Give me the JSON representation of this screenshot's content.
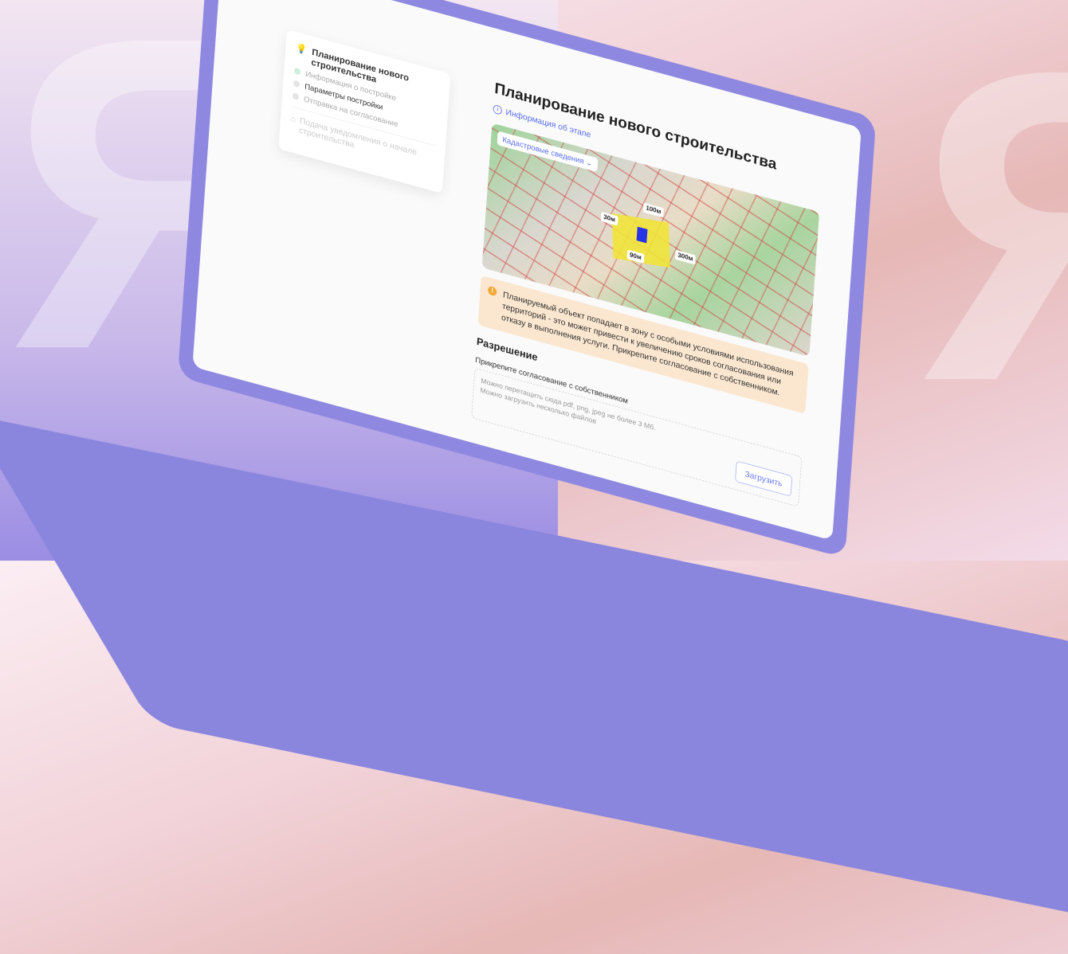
{
  "background": {
    "letter": "Я"
  },
  "stepper": {
    "title": "Планирование нового строительства",
    "steps": [
      {
        "label": "Информация о постройке",
        "state": "done"
      },
      {
        "label": "Параметры постройки",
        "state": "active"
      },
      {
        "label": "Отправка на согласование",
        "state": "pending"
      }
    ],
    "next_stage": "Подача уведомления о начале строительства"
  },
  "main": {
    "title": "Планирование нового строительства",
    "info_link": "Информация об этапе",
    "map": {
      "dropdown": "Кадастровые сведения",
      "labels": [
        "100м",
        "30м",
        "300м",
        "90м"
      ],
      "accent": "#2733e6"
    },
    "warning": "Планируемый объект попадает в зону с особыми условиями использования территорий - это может привести к увеличению сроков согласования или отказу в выполнения услуги. Прикрепите согласование с собственником.",
    "section_title": "Разрешение",
    "upload": {
      "label": "Прикрепите согласование с собственником",
      "hint1": "Можно перетащить сюда pdf, png, jpeg не более 3 Мб.",
      "hint2": "Можно загрузить несколько файлов",
      "button": "Загрузить"
    }
  }
}
